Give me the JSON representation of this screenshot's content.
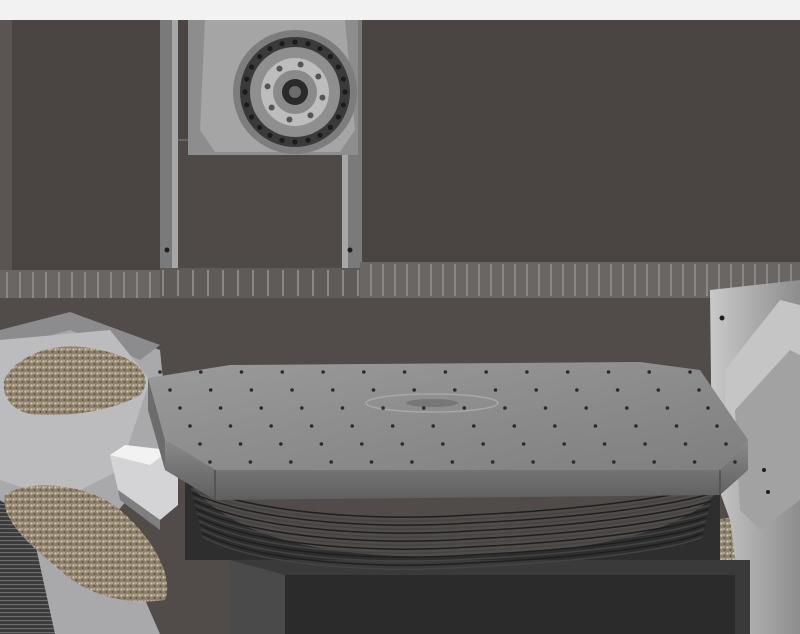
{
  "scene": {
    "subject": "cnc-machine-render",
    "colors": {
      "top_band": "#f2f2f2",
      "wall": "#4a4542",
      "spindle_housing": "#9a9a9a",
      "spindle_dark": "#2f2f2f",
      "bellows": "#6a6a6a",
      "table_top": "#8f8f8f",
      "table_side": "#747474",
      "rotary_base": "#2c2c2c",
      "chips": "#9c8f7a",
      "panel": "#b3b3b3"
    }
  }
}
